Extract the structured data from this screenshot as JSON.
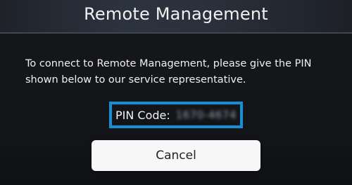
{
  "dialog": {
    "title": "Remote Management",
    "message": "To connect to Remote Management, please give the PIN shown below to our service representative.",
    "pin_label": "PIN Code:",
    "pin_value": "1670-4674",
    "cancel_label": "Cancel"
  },
  "colors": {
    "highlight_border": "#1391d6",
    "button_background": "#f7f7f7",
    "dialog_background": "#14161a"
  }
}
